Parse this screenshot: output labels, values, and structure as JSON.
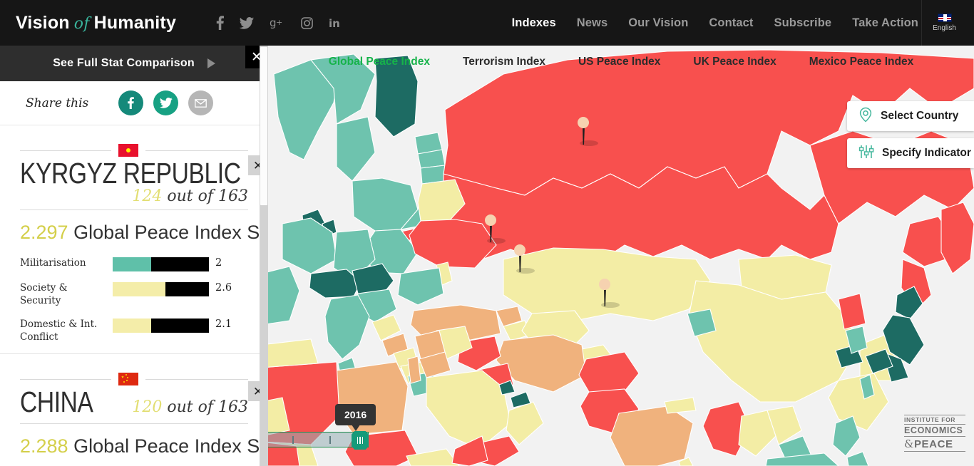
{
  "header": {
    "brand_pre": "Vision",
    "brand_of": "of",
    "brand_post": "Humanity",
    "social": [
      {
        "name": "facebook-icon",
        "glyph": "f"
      },
      {
        "name": "twitter-icon",
        "glyph": "t"
      },
      {
        "name": "googleplus-icon",
        "glyph": "g+"
      },
      {
        "name": "instagram-icon",
        "glyph": "ig"
      },
      {
        "name": "linkedin-icon",
        "glyph": "in"
      }
    ],
    "menu": [
      {
        "label": "Indexes",
        "active": true
      },
      {
        "label": "News",
        "active": false
      },
      {
        "label": "Our Vision",
        "active": false
      },
      {
        "label": "Contact",
        "active": false
      },
      {
        "label": "Subscribe",
        "active": false
      },
      {
        "label": "Take Action",
        "active": false
      }
    ],
    "language": "English"
  },
  "index_tabs": [
    {
      "label": "Global Peace Index",
      "active": true
    },
    {
      "label": "Terrorism Index",
      "active": false
    },
    {
      "label": "US Peace Index",
      "active": false
    },
    {
      "label": "UK Peace Index",
      "active": false
    },
    {
      "label": "Mexico Peace Index",
      "active": false
    }
  ],
  "map_controls": {
    "select_country": "Select Country",
    "specify_indicator": "Specify Indicator"
  },
  "timeline": {
    "year": "2016"
  },
  "logo": {
    "line1": "INSTITUTE FOR",
    "line2": "ECONOMICS",
    "line3_amp": "&",
    "line3": "PEACE"
  },
  "panel": {
    "compare_label": "See Full Stat Comparison",
    "close_glyph": "✕",
    "share_label": "Share this",
    "countries": [
      {
        "name": "KYRGYZ REPUBLIC",
        "flag": "kg",
        "rank": "124",
        "rank_suffix": "out of 163",
        "score": "2.297",
        "score_label": "Global Peace Index Score",
        "metrics": [
          {
            "label": "Militarisation",
            "value": "2",
            "fill_pct": 40,
            "color": "#5fc0a9"
          },
          {
            "label": "Society & Security",
            "value": "2.6",
            "fill_pct": 55,
            "color": "#f4eda9"
          },
          {
            "label": "Domestic & Int. Conflict",
            "value": "2.1",
            "fill_pct": 40,
            "color": "#f4eda9"
          }
        ]
      },
      {
        "name": "CHINA",
        "flag": "cn",
        "rank": "120",
        "rank_suffix": "out of 163",
        "score": "2.288",
        "score_label": "Global Peace Index Score",
        "metrics": []
      }
    ]
  },
  "colors": {
    "very_high": "#1d6b63",
    "high": "#6ec3ae",
    "medium": "#f3eda5",
    "low": "#f0b27d",
    "very_low": "#f8504e",
    "accent_green": "#16b34a",
    "accent_teal": "#17a183",
    "yellow": "#d4cf4a"
  }
}
